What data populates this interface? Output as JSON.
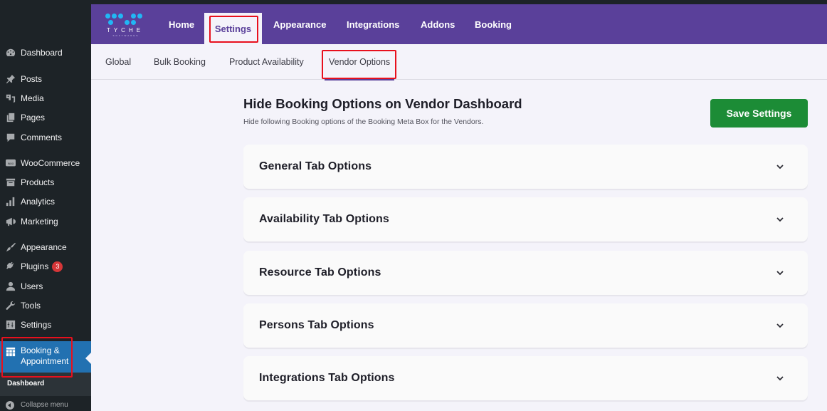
{
  "sidebar": {
    "items": [
      {
        "label": "Dashboard",
        "icon": "dashboard-icon"
      },
      {
        "label": "Posts",
        "icon": "pin-icon"
      },
      {
        "label": "Media",
        "icon": "media-icon"
      },
      {
        "label": "Pages",
        "icon": "pages-icon"
      },
      {
        "label": "Comments",
        "icon": "comment-icon"
      },
      {
        "label": "WooCommerce",
        "icon": "woo-icon"
      },
      {
        "label": "Products",
        "icon": "archive-icon"
      },
      {
        "label": "Analytics",
        "icon": "bar-chart-icon"
      },
      {
        "label": "Marketing",
        "icon": "megaphone-icon"
      },
      {
        "label": "Appearance",
        "icon": "paintbrush-icon"
      },
      {
        "label": "Plugins",
        "icon": "plug-icon",
        "badge": "3"
      },
      {
        "label": "Users",
        "icon": "user-icon"
      },
      {
        "label": "Tools",
        "icon": "wrench-icon"
      },
      {
        "label": "Settings",
        "icon": "sliders-icon"
      }
    ],
    "active": {
      "label_line1": "Booking &",
      "label_line2": "Appointment",
      "icon": "calendar-grid-icon"
    },
    "submenu": {
      "label": "Dashboard"
    },
    "collapse_label": "Collapse menu"
  },
  "header": {
    "logo_word": "TYCHE",
    "logo_sub": "SOFTWARES",
    "nav": [
      {
        "label": "Home"
      },
      {
        "label": "Settings",
        "active": true
      },
      {
        "label": "Appearance"
      },
      {
        "label": "Integrations"
      },
      {
        "label": "Addons"
      },
      {
        "label": "Booking"
      }
    ]
  },
  "subtabs": [
    {
      "label": "Global"
    },
    {
      "label": "Bulk Booking"
    },
    {
      "label": "Product Availability"
    },
    {
      "label": "Vendor Options",
      "active": true
    }
  ],
  "main": {
    "title": "Hide Booking Options on Vendor Dashboard",
    "description": "Hide following Booking options of the Booking Meta Box for the Vendors.",
    "save_label": "Save Settings",
    "sections": [
      {
        "label": "General Tab Options"
      },
      {
        "label": "Availability Tab Options"
      },
      {
        "label": "Resource Tab Options"
      },
      {
        "label": "Persons Tab Options"
      },
      {
        "label": "Integrations Tab Options"
      }
    ]
  },
  "colors": {
    "header_purple": "#5a409a",
    "save_green": "#1c8c36",
    "wp_sidebar": "#1d2327",
    "wp_active": "#2271b1",
    "highlight_red": "#e8101d",
    "logo_blue": "#21b7f5"
  }
}
